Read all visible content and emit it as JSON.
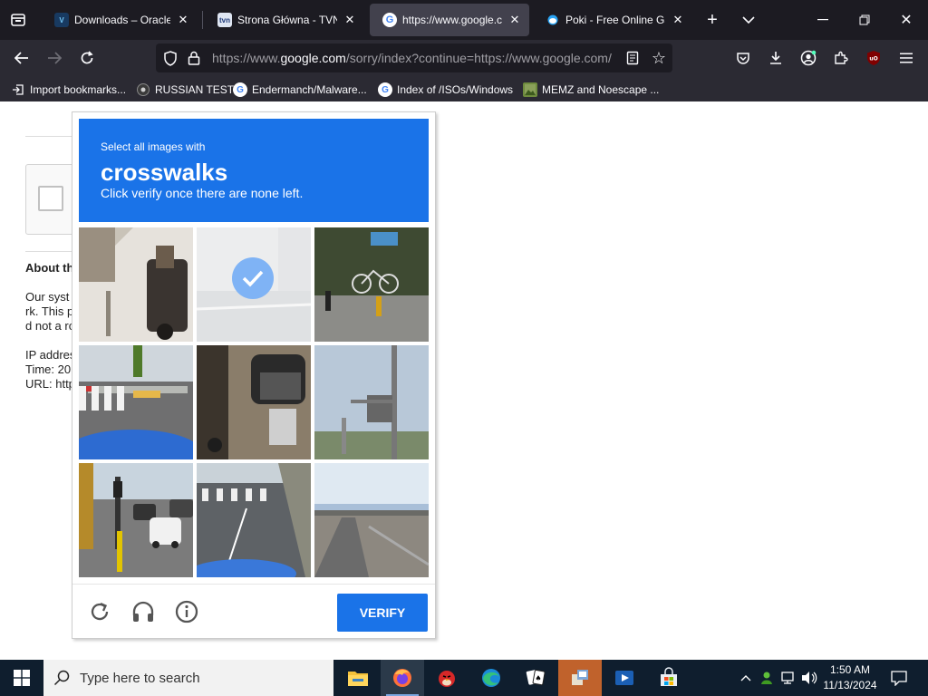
{
  "browser": {
    "tabs": [
      {
        "title": "Downloads – Oracle VirtualBox",
        "favicon": "virtualbox-favicon",
        "active": false
      },
      {
        "title": "Strona Główna - TVN",
        "favicon": "tvn-favicon",
        "active": false
      },
      {
        "title": "https://www.google.com/sorry/index",
        "favicon": "google-favicon",
        "active": true
      },
      {
        "title": "Poki - Free Online Games",
        "favicon": "poki-favicon",
        "active": false
      }
    ],
    "url_prefix": "https://www.",
    "url_domain": "google.com",
    "url_rest": "/sorry/index?continue=https://www.google.com/",
    "bookmarks": [
      {
        "label": "Import bookmarks...",
        "icon": "import-icon"
      },
      {
        "label": "RUSSIAN TEST",
        "icon": "spider-icon"
      },
      {
        "label": "Endermanch/Malware...",
        "icon": "google-icon"
      },
      {
        "label": "Index of /ISOs/Windows",
        "icon": "google-icon"
      },
      {
        "label": "MEMZ and Noescape ...",
        "icon": "image-icon"
      }
    ]
  },
  "page": {
    "about_heading": "About th",
    "text_lines": [
      "Our syst",
      "rk. This p",
      "d not a ro",
      "IP addres",
      "Time: 20",
      "URL: http"
    ]
  },
  "captcha": {
    "instruction_pre": "Select all images with",
    "target_word": "crosswalks",
    "instruction_post": "Click verify once there are none left.",
    "verify_label": "VERIFY",
    "tiles": [
      {
        "name": "tile-scooter-sidewalk",
        "selected": false
      },
      {
        "name": "tile-selected",
        "selected": true
      },
      {
        "name": "tile-bicycle-street",
        "selected": false
      },
      {
        "name": "tile-crosswalk-road",
        "selected": false
      },
      {
        "name": "tile-motorbike",
        "selected": false
      },
      {
        "name": "tile-traffic-pole",
        "selected": false
      },
      {
        "name": "tile-traffic-cars",
        "selected": false
      },
      {
        "name": "tile-crosswalk-intersection",
        "selected": false
      },
      {
        "name": "tile-highway-bridge",
        "selected": false
      }
    ]
  },
  "taskbar": {
    "search_placeholder": "Type here to search",
    "apps": [
      "file-explorer-icon",
      "firefox-icon",
      "angry-birds-icon",
      "edge-icon",
      "solitaire-icon",
      "installer-icon",
      "video-app-icon",
      "store-icon"
    ],
    "time": "1:50 AM",
    "date": "11/13/2024"
  },
  "colors": {
    "captcha_blue": "#1a73e8",
    "tab_bar": "#1c1b22",
    "toolbar": "#2b2a33",
    "taskbar": "#0f1e2e"
  }
}
